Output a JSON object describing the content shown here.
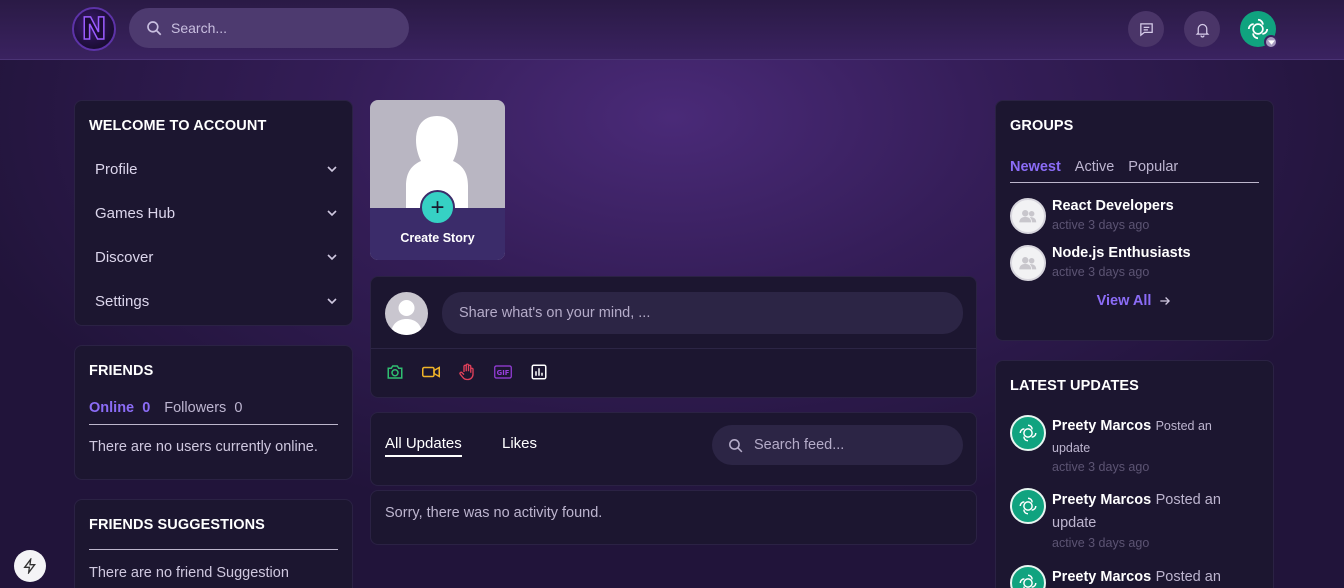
{
  "topbar": {
    "logo_letter": "N",
    "search_placeholder": "Search..."
  },
  "account": {
    "title": "WELCOME TO ACCOUNT",
    "items": [
      {
        "label": "Profile"
      },
      {
        "label": "Games Hub"
      },
      {
        "label": "Discover"
      },
      {
        "label": "Settings"
      }
    ]
  },
  "friends": {
    "title": "FRIENDS",
    "online_label": "Online",
    "online_count": "0",
    "followers_label": "Followers",
    "followers_count": "0",
    "empty_text": "There are no users currently online."
  },
  "suggestions": {
    "title": "FRIENDS SUGGESTIONS",
    "empty_text": "There are no friend Suggestion"
  },
  "story": {
    "plus": "+",
    "label": "Create Story"
  },
  "composer": {
    "placeholder": "Share what's on your mind, ...",
    "tools": [
      {
        "icon": "camera-icon",
        "color": "#2fbf71"
      },
      {
        "icon": "video-icon",
        "color": "#f0b429"
      },
      {
        "icon": "hand-icon",
        "color": "#e0405a"
      },
      {
        "icon": "gif-icon",
        "color": "#9b3fe0"
      },
      {
        "icon": "poll-icon",
        "color": "#ffffff"
      }
    ]
  },
  "feed": {
    "tabs": [
      "All Updates",
      "Likes"
    ],
    "active_tab": "All Updates",
    "search_placeholder": "Search feed...",
    "empty_text": "Sorry, there was no activity found."
  },
  "groups": {
    "title": "GROUPS",
    "tabs": [
      "Newest",
      "Active",
      "Popular"
    ],
    "active_tab": "Newest",
    "items": [
      {
        "name": "React Developers",
        "time": "active 3 days ago"
      },
      {
        "name": "Node.js Enthusiasts",
        "time": "active 3 days ago"
      }
    ],
    "view_all": "View All"
  },
  "updates": {
    "title": "LATEST UPDATES",
    "items": [
      {
        "name": "Preety Marcos",
        "action": "Posted an update",
        "time": "active 3 days ago"
      },
      {
        "name": "Preety Marcos",
        "action": "Posted an update",
        "time": "active 3 days ago"
      },
      {
        "name": "Preety Marcos",
        "action": "Posted an update",
        "time": ""
      }
    ]
  },
  "colors": {
    "accent": "#8b6cf6",
    "teal": "#36d1c4",
    "card": "#1c1630"
  }
}
